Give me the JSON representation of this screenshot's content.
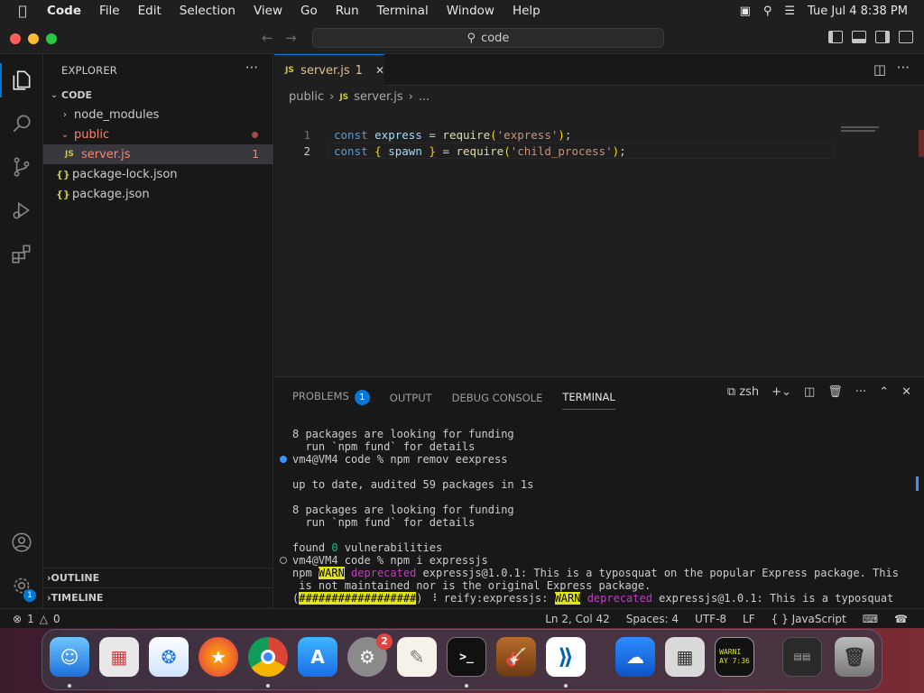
{
  "menubar": {
    "app": "Code",
    "items": [
      "File",
      "Edit",
      "Selection",
      "View",
      "Go",
      "Run",
      "Terminal",
      "Window",
      "Help"
    ],
    "datetime": "Tue Jul 4  8:38 PM"
  },
  "titlebar": {
    "search": "code"
  },
  "sidebar": {
    "header": "EXPLORER",
    "more": "···",
    "root": "CODE",
    "items": [
      {
        "label": "node_modules"
      },
      {
        "label": "public"
      },
      {
        "label": "server.js",
        "badge": "JS",
        "problems": "1"
      },
      {
        "label": "package-lock.json",
        "badge": "{}"
      },
      {
        "label": "package.json",
        "badge": "{}"
      }
    ],
    "outline": "OUTLINE",
    "timeline": "TIMELINE"
  },
  "editor": {
    "tab": {
      "badge": "JS",
      "label": "server.js",
      "count": "1",
      "close": "✕"
    },
    "breadcrumb": [
      "public",
      "server.js",
      "..."
    ],
    "breadcrumb_badge": "JS",
    "lines": [
      {
        "num": "1",
        "tokens": [
          [
            "kw",
            "const "
          ],
          [
            "vr",
            "express"
          ],
          [
            "pn",
            " = "
          ],
          [
            "fn",
            "require"
          ],
          [
            "br",
            "("
          ],
          [
            "str",
            "'express'"
          ],
          [
            "br",
            ")"
          ],
          [
            "pn",
            ";"
          ]
        ]
      },
      {
        "num": "2",
        "tokens": [
          [
            "kw",
            "const "
          ],
          [
            "br",
            "{ "
          ],
          [
            "vr",
            "spawn"
          ],
          [
            "br",
            " }"
          ],
          [
            "pn",
            " = "
          ],
          [
            "fn",
            "require"
          ],
          [
            "br",
            "("
          ],
          [
            "str",
            "'child_process'"
          ],
          [
            "br",
            ")"
          ],
          [
            "pn",
            ";"
          ]
        ]
      }
    ]
  },
  "panel": {
    "tabs": [
      "PROBLEMS",
      "OUTPUT",
      "DEBUG CONSOLE",
      "TERMINAL"
    ],
    "problems_count": "1",
    "shell": "zsh",
    "terminal": [
      {
        "text": "8 packages are looking for funding"
      },
      {
        "text": "  run `npm fund` for details"
      },
      {
        "text": "vm4@VM4 code % npm remov eexpress",
        "dot": "#3794ff"
      },
      {
        "text": ""
      },
      {
        "text": "up to date, audited 59 packages in 1s"
      },
      {
        "text": ""
      },
      {
        "text": "8 packages are looking for funding"
      },
      {
        "text": "  run `npm fund` for details"
      },
      {
        "text": ""
      },
      {
        "parts": [
          [
            "",
            "found "
          ],
          [
            "grn",
            "0"
          ],
          [
            "",
            " vulnerabilities"
          ]
        ]
      },
      {
        "text": "vm4@VM4 code % npm i expressjs",
        "dot": "hollow"
      },
      {
        "parts": [
          [
            "",
            "npm "
          ],
          [
            "warn",
            "WARN"
          ],
          [
            "",
            " "
          ],
          [
            "dep",
            "deprecated"
          ],
          [
            "",
            " expressjs@1.0.1: This is a typosquat on the popular Express package. This"
          ]
        ]
      },
      {
        "text": " is not maintained nor is the original Express package."
      },
      {
        "parts": [
          [
            "",
            "("
          ],
          [
            "warn",
            "##################"
          ],
          [
            "",
            ") ⠸ reify:expressjs: "
          ],
          [
            "warn",
            "WARN"
          ],
          [
            "",
            " "
          ],
          [
            "dep",
            "deprecated"
          ],
          [
            "",
            " expressjs@1.0.1: This is a typosquat"
          ]
        ]
      }
    ]
  },
  "status": {
    "errors": "1",
    "warnings": "0",
    "position": "Ln 2, Col 42",
    "spaces": "Spaces: 4",
    "encoding": "UTF-8",
    "eol": "LF",
    "language": "JavaScript"
  },
  "dock": {
    "settings_badge": "2",
    "console_text": "WARNI\nAY 7:36",
    "terminal_text": ">_"
  },
  "colors": {
    "accent": "#0078d4",
    "error": "#f14c4c",
    "modified": "#e2c08d"
  }
}
